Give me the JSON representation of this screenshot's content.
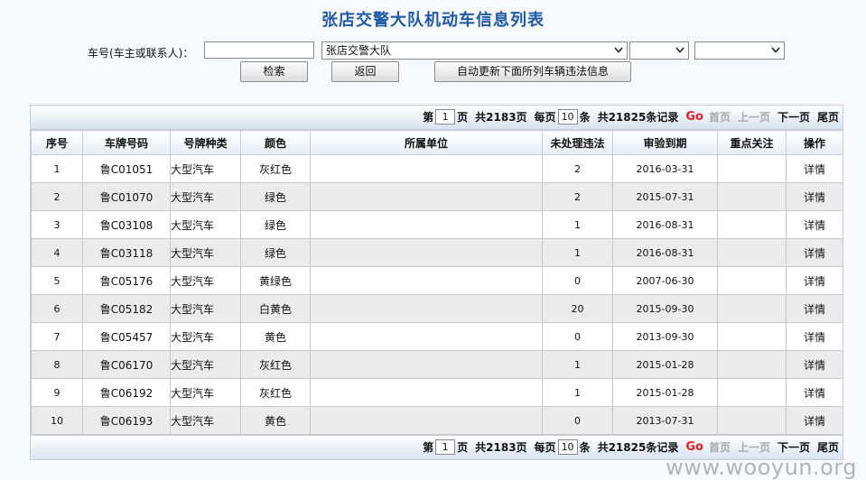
{
  "page": {
    "title": "张店交警大队机动车信息列表"
  },
  "search": {
    "label": "车号(车主或联系人)：",
    "input_value": "",
    "unit_select": "张店交警大队",
    "select2": "",
    "select3": "",
    "search_button": "检索",
    "back_button": "返回",
    "update_button": "自动更新下面所列车辆违法信息"
  },
  "pager": {
    "di": "第",
    "page": "1",
    "ye": "页",
    "total_pages": "共2183页",
    "per_page_label": "每页",
    "per_page": "10",
    "tiao": "条",
    "total_records": "共21825条记录",
    "go": "Go",
    "first": "首页",
    "prev": "上一页",
    "next": "下一页",
    "last": "尾页"
  },
  "table": {
    "headers": [
      "序号",
      "车牌号码",
      "号牌种类",
      "颜色",
      "所属单位",
      "未处理违法",
      "审验到期",
      "重点关注",
      "操作"
    ],
    "rows": [
      {
        "no": "1",
        "plate": "鲁C01051",
        "type": "大型汽车",
        "color": "灰红色",
        "unit": "",
        "violations": "2",
        "expiry": "2016-03-31",
        "focus": "",
        "op": "详情"
      },
      {
        "no": "2",
        "plate": "鲁C01070",
        "type": "大型汽车",
        "color": "绿色",
        "unit": "",
        "violations": "2",
        "expiry": "2015-07-31",
        "focus": "",
        "op": "详情"
      },
      {
        "no": "3",
        "plate": "鲁C03108",
        "type": "大型汽车",
        "color": "绿色",
        "unit": "",
        "violations": "1",
        "expiry": "2016-08-31",
        "focus": "",
        "op": "详情"
      },
      {
        "no": "4",
        "plate": "鲁C03118",
        "type": "大型汽车",
        "color": "绿色",
        "unit": "",
        "violations": "1",
        "expiry": "2016-08-31",
        "focus": "",
        "op": "详情"
      },
      {
        "no": "5",
        "plate": "鲁C05176",
        "type": "大型汽车",
        "color": "黄绿色",
        "unit": "",
        "violations": "0",
        "expiry": "2007-06-30",
        "focus": "",
        "op": "详情"
      },
      {
        "no": "6",
        "plate": "鲁C05182",
        "type": "大型汽车",
        "color": "白黄色",
        "unit": "",
        "violations": "20",
        "expiry": "2015-09-30",
        "focus": "",
        "op": "详情"
      },
      {
        "no": "7",
        "plate": "鲁C05457",
        "type": "大型汽车",
        "color": "黄色",
        "unit": "",
        "violations": "0",
        "expiry": "2013-09-30",
        "focus": "",
        "op": "详情"
      },
      {
        "no": "8",
        "plate": "鲁C06170",
        "type": "大型汽车",
        "color": "灰红色",
        "unit": "",
        "violations": "1",
        "expiry": "2015-01-28",
        "focus": "",
        "op": "详情"
      },
      {
        "no": "9",
        "plate": "鲁C06192",
        "type": "大型汽车",
        "color": "灰红色",
        "unit": "",
        "violations": "1",
        "expiry": "2015-01-28",
        "focus": "",
        "op": "详情"
      },
      {
        "no": "10",
        "plate": "鲁C06193",
        "type": "大型汽车",
        "color": "黄色",
        "unit": "",
        "violations": "0",
        "expiry": "2013-07-31",
        "focus": "",
        "op": "详情"
      }
    ]
  },
  "watermark": "www.wooyun.org",
  "colors": {
    "title": "#1f5aa8",
    "go": "#e8201f",
    "row_alt": "#ebebeb"
  }
}
